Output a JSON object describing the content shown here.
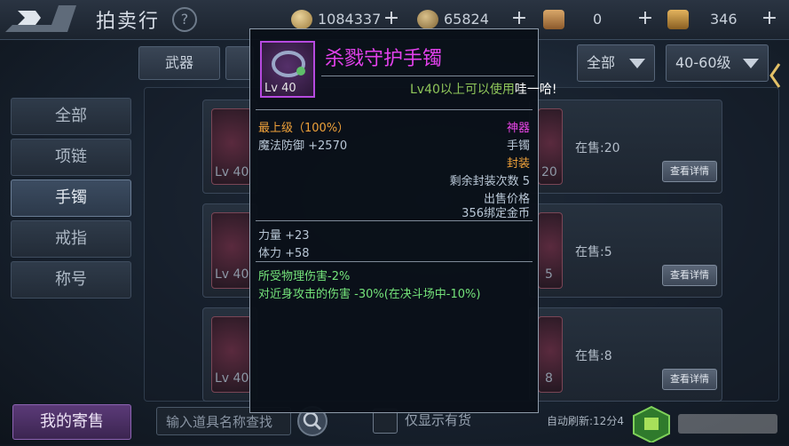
{
  "header": {
    "title": "拍卖行",
    "help": "?"
  },
  "currencies": [
    {
      "value": "1084337"
    },
    {
      "value": "65824"
    },
    {
      "value": "0"
    },
    {
      "value": "346"
    }
  ],
  "filters": {
    "tab1": "武器",
    "dropdown1": "全部",
    "dropdown2": "40-60级"
  },
  "sidebar": {
    "items": [
      {
        "label": "全部"
      },
      {
        "label": "项链"
      },
      {
        "label": "手镯"
      },
      {
        "label": "戒指"
      },
      {
        "label": "称号"
      }
    ],
    "active_index": 2
  },
  "listings": [
    {
      "level": "Lv 40",
      "level_right": "20",
      "name": "",
      "on_sale": "在售:20",
      "button": "查看详情"
    },
    {
      "level": "Lv 40",
      "level_right": "5",
      "name": "",
      "on_sale": "在售:5",
      "button": "查看详情"
    },
    {
      "level": "Lv 40",
      "level_right": "8",
      "name": "",
      "on_sale": "在售:8",
      "button": "查看详情"
    }
  ],
  "bottom": {
    "my_consign": "我的寄售",
    "search_placeholder": "输入道具名称查找",
    "checkbox_label": "仅显示有货",
    "refresh": "自动刷新:12分4"
  },
  "tooltip": {
    "name": "杀戮守护手镯",
    "level": "Lv 40",
    "requirement": "Lv40以上可以使用",
    "requirement_extra": "哇一哈!",
    "grade": "最上级（100%）",
    "rarity": "神器",
    "stat_main": "魔法防御 +2570",
    "type": "手镯",
    "sealed": "封装",
    "seal_remaining": "剩余封装次数 5",
    "price_label": "出售价格",
    "price": "356绑定金币",
    "attr1": "力量 +23",
    "attr2": "体力 +58",
    "effect1": "所受物理伤害-2%",
    "effect2": "对近身攻击的伤害 -30%(在决斗场中-10%)"
  },
  "colors": {
    "epic": "#e241ec",
    "grade": "#f0a23a",
    "effect": "#74e37a",
    "requirement": "#8fc65a"
  }
}
